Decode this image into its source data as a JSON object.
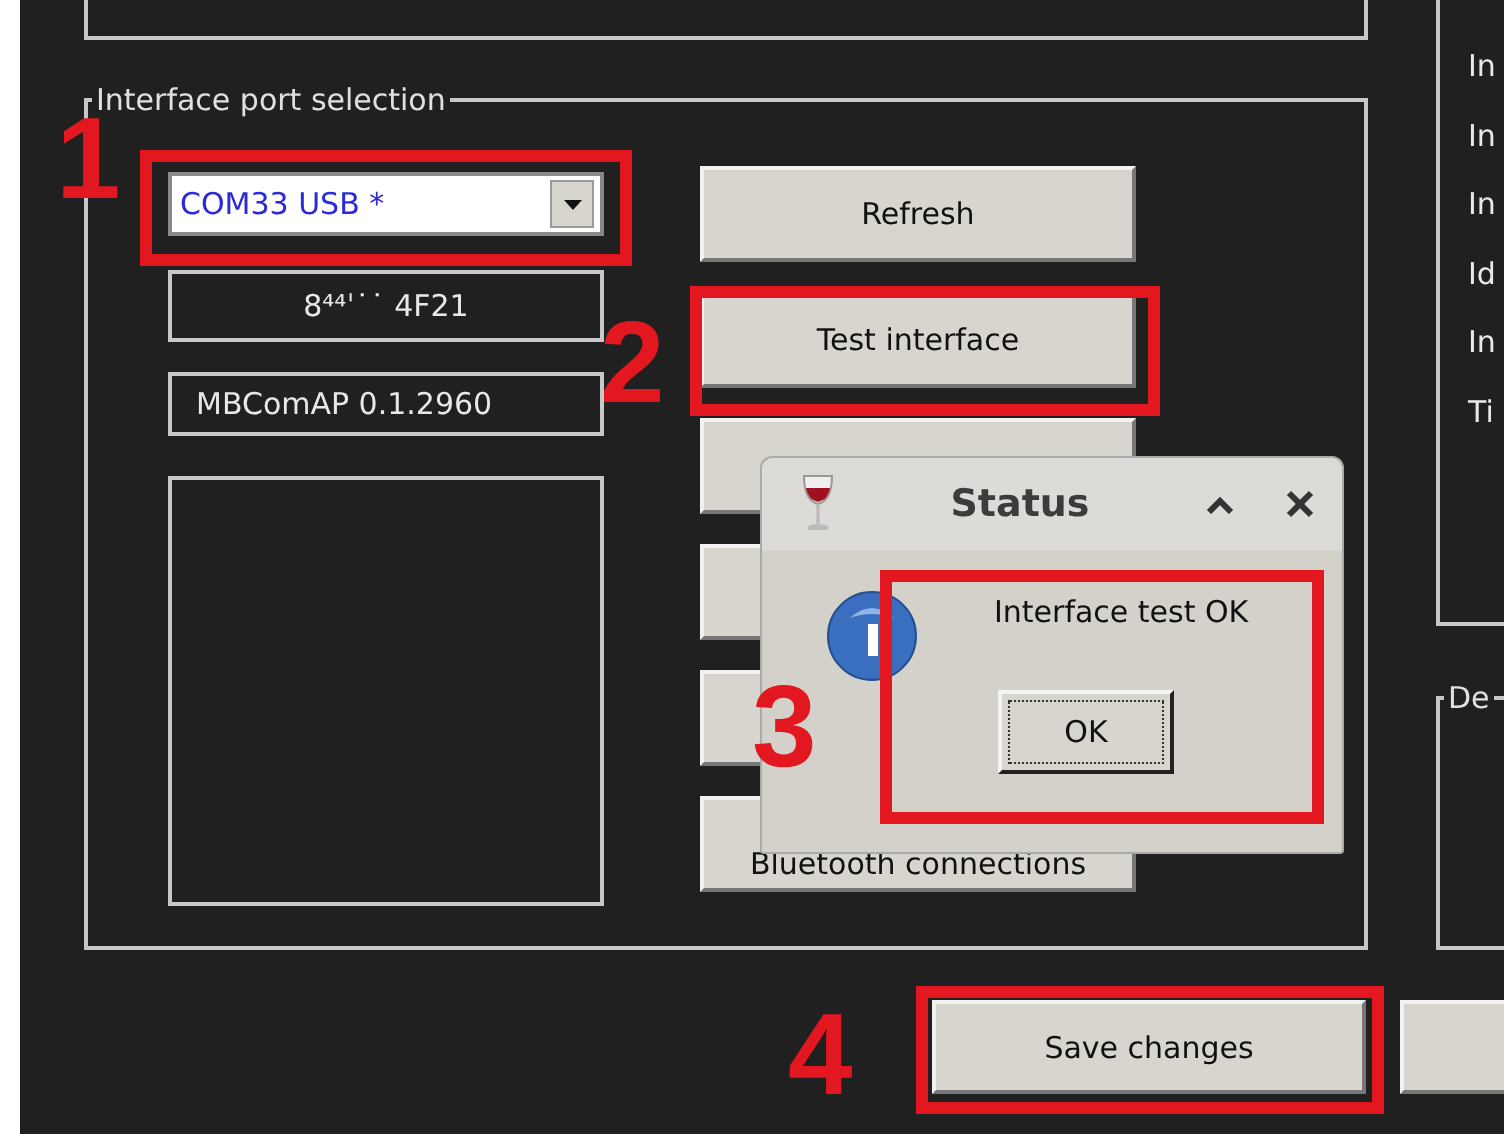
{
  "port_group": {
    "title": "Interface port selection",
    "port_select": {
      "value": "COM33 USB *"
    },
    "fields": [
      "8⁴⁴ˈ˙˙ 4F21",
      "MBComAP 0.1.2960"
    ],
    "buttons": [
      {
        "kind": "text",
        "label": "Refresh"
      },
      {
        "kind": "text",
        "label": "Test interface"
      },
      {
        "kind": "covered"
      },
      {
        "kind": "covered"
      },
      {
        "kind": "covered"
      },
      {
        "kind": "text",
        "label": "Bluetooth connections"
      }
    ]
  },
  "info_panel": {
    "labels": [
      "In",
      "In",
      "In",
      "Id",
      "In",
      "Ti"
    ]
  },
  "device_group": {
    "title": "De"
  },
  "footer_buttons": [
    {
      "kind": "text",
      "label": "Save changes"
    },
    {
      "kind": "covered"
    }
  ],
  "dialog": {
    "title": "Status",
    "message": "Interface test OK",
    "button": "OK"
  },
  "annotations": [
    "1",
    "2",
    "3",
    "4"
  ]
}
